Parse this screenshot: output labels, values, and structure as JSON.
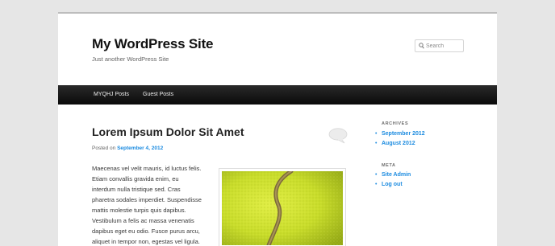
{
  "site": {
    "title": "My WordPress Site",
    "description": "Just another WordPress Site"
  },
  "search": {
    "placeholder": "Search",
    "icon": "search-icon"
  },
  "nav": {
    "items": [
      {
        "label": "MYQHJ Posts"
      },
      {
        "label": "Guest Posts"
      }
    ]
  },
  "post": {
    "title": "Lorem Ipsum Dolor Sit Amet",
    "meta_prefix": "Posted on",
    "date": "September 4, 2012",
    "body_lines": [
      "Maecenas vel velit mauris, id luctus felis.",
      "Etiam convallis gravida enim, eu",
      "interdum nulla tristique sed. Cras",
      "pharetra sodales imperdiet. Suspendisse",
      "mattis molestie turpis quis dapibus.",
      "Vestibulum a felis ac massa venenatis",
      "dapibus eget eu odio. Fusce purus arcu,",
      "aliquet in tempor non, egestas vel ligula."
    ],
    "image_subject": "tennis ball"
  },
  "sidebar": {
    "archives": {
      "title": "ARCHIVES",
      "items": [
        {
          "label": "September 2012"
        },
        {
          "label": "August 2012"
        }
      ]
    },
    "meta": {
      "title": "META",
      "items": [
        {
          "label": "Site Admin"
        },
        {
          "label": "Log out"
        }
      ]
    }
  },
  "colors": {
    "link": "#1b8be0",
    "nav_bg": "#111111",
    "ball": "#c8dc2a"
  }
}
